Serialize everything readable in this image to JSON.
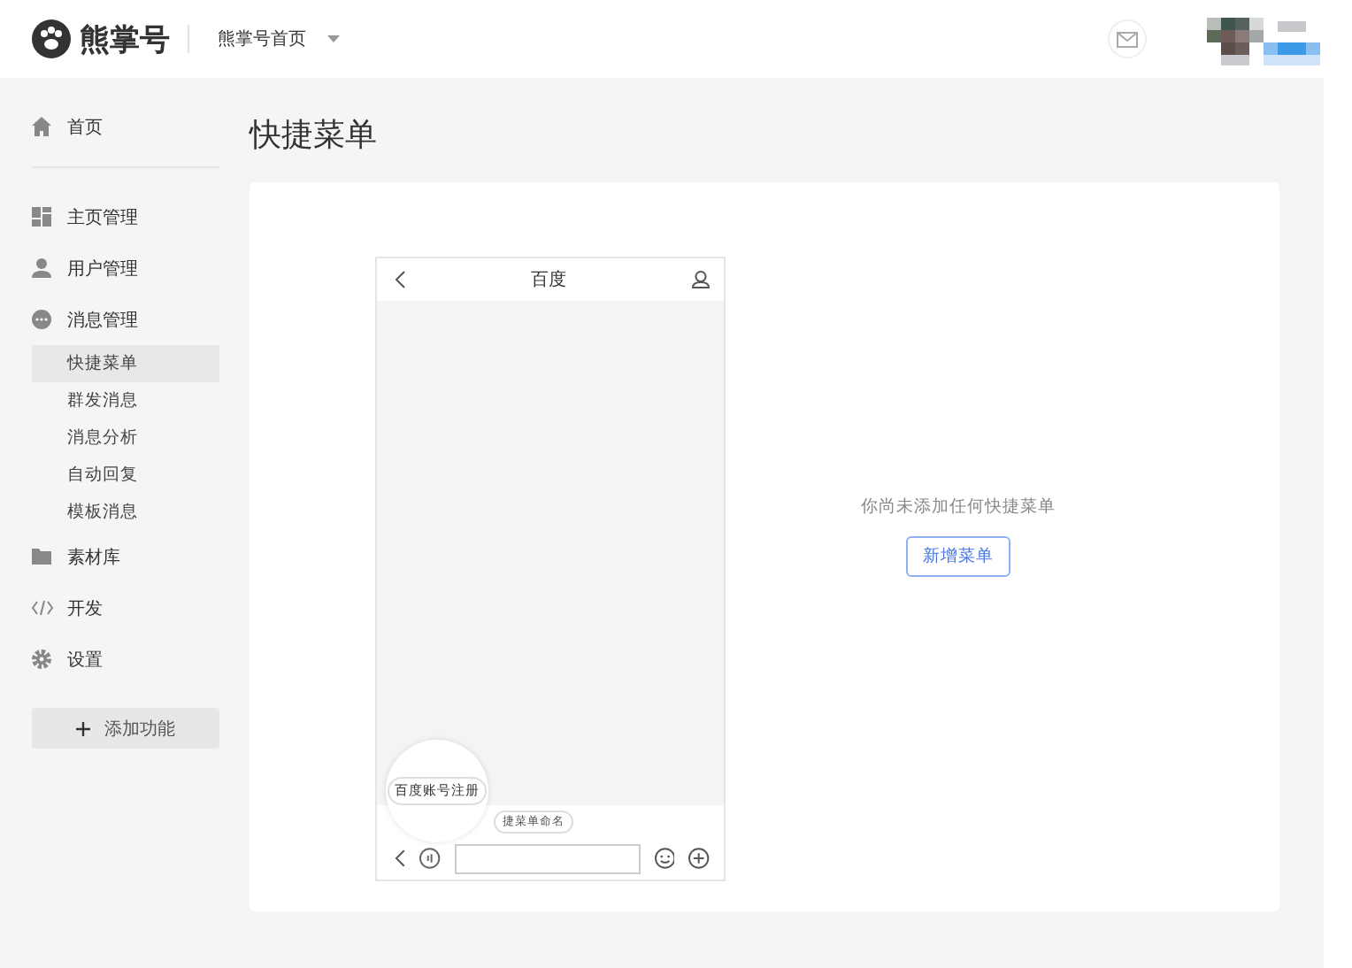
{
  "header": {
    "logo_text": "熊掌号",
    "nav_label": "熊掌号首页"
  },
  "sidebar": {
    "items": [
      {
        "label": "首页",
        "selected": false
      },
      {
        "label": "主页管理",
        "selected": false
      },
      {
        "label": "用户管理",
        "selected": false
      },
      {
        "label": "消息管理",
        "selected": false,
        "children": [
          {
            "label": "快捷菜单",
            "selected": true
          },
          {
            "label": "群发消息",
            "selected": false
          },
          {
            "label": "消息分析",
            "selected": false
          },
          {
            "label": "自动回复",
            "selected": false
          },
          {
            "label": "模板消息",
            "selected": false
          }
        ]
      },
      {
        "label": "素材库",
        "selected": false
      },
      {
        "label": "开发",
        "selected": false
      },
      {
        "label": "设置",
        "selected": false
      }
    ],
    "add_button": "添加功能"
  },
  "page": {
    "title": "快捷菜单"
  },
  "phone": {
    "title": "百度",
    "magnified_chip": "百度账号注册",
    "chip": "捷菜单命名"
  },
  "empty_state": {
    "message": "你尚未添加任何快捷菜单",
    "button": "新增菜单"
  }
}
